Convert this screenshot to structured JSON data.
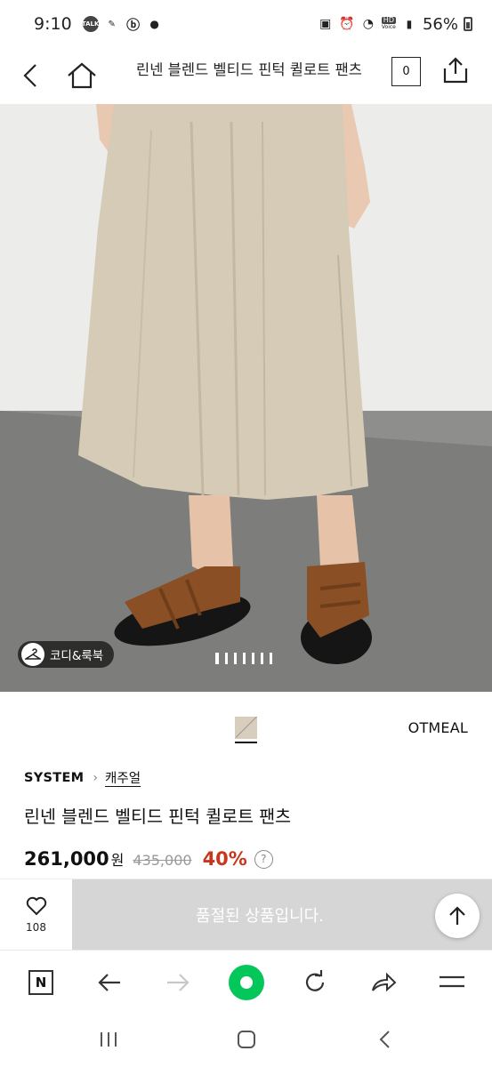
{
  "status_bar": {
    "time": "9:10",
    "battery": "56%",
    "hd_label": "HD",
    "voice_label": "Voice"
  },
  "header": {
    "title": "린넨 블렌드 벨티드 핀턱 퀼로트 팬츠",
    "cart_count": "0"
  },
  "gallery": {
    "coord_label": "코디&룩북",
    "image_count": 7,
    "current_index": 1
  },
  "color": {
    "name": "OTMEAL",
    "chip_color": "#d9cebe"
  },
  "product": {
    "brand": "SYSTEM",
    "category": "캐주얼",
    "name": "린넨 블렌드 벨티드 핀턱 퀼로트 팬츠",
    "sale_price": "261,000",
    "currency": "원",
    "original_price": "435,000",
    "discount": "40%"
  },
  "purchase_bar": {
    "like_count": "108",
    "soldout_label": "품절된 상품입니다."
  },
  "colors": {
    "discount_red": "#c8371d",
    "naver_green": "#03c75a",
    "soldout_gray": "#d6d6d6"
  }
}
